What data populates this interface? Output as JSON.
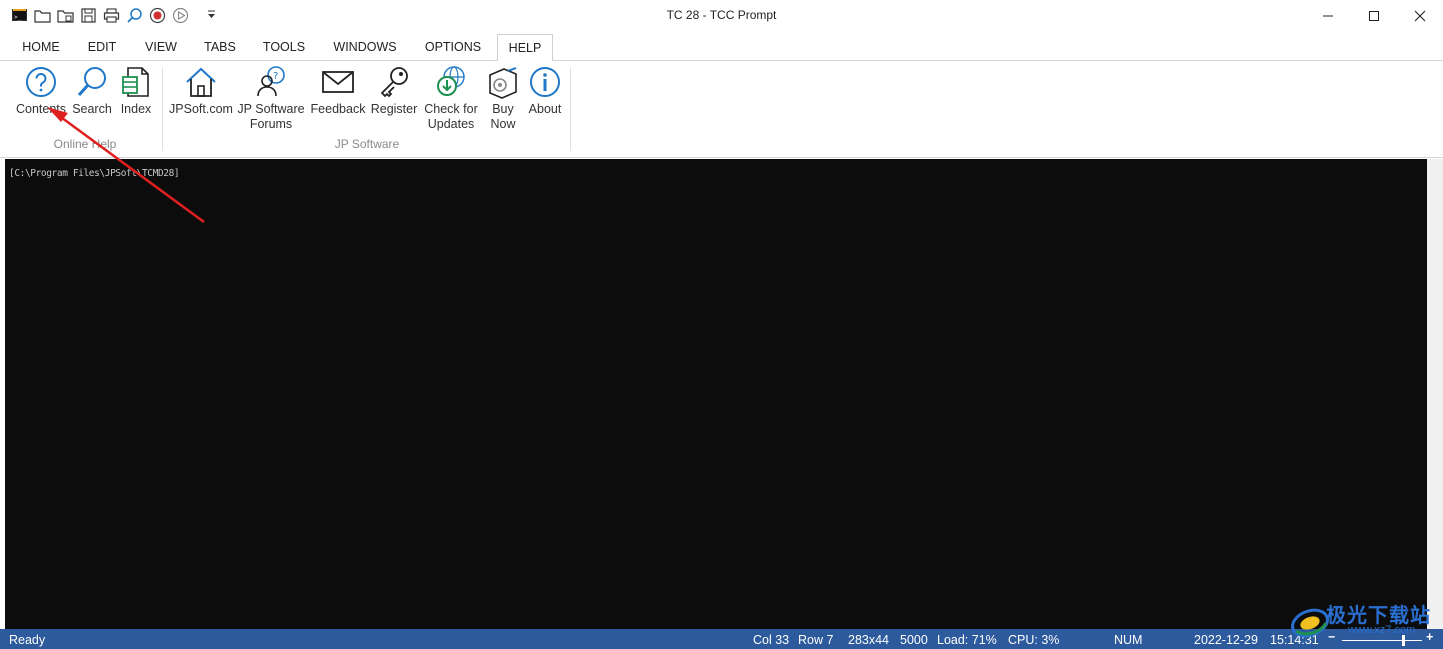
{
  "window": {
    "title": "TC 28 - TCC Prompt"
  },
  "quick_access": [
    {
      "name": "app-icon"
    },
    {
      "name": "new-folder-icon"
    },
    {
      "name": "open-folder-icon"
    },
    {
      "name": "save-icon"
    },
    {
      "name": "print-icon"
    },
    {
      "name": "search-icon"
    },
    {
      "name": "record-icon"
    },
    {
      "name": "play-icon"
    },
    {
      "name": "dropdown-icon"
    }
  ],
  "menu_tabs": [
    {
      "label": "HOME"
    },
    {
      "label": "EDIT"
    },
    {
      "label": "VIEW"
    },
    {
      "label": "TABS"
    },
    {
      "label": "TOOLS"
    },
    {
      "label": "WINDOWS"
    },
    {
      "label": "OPTIONS"
    },
    {
      "label": "HELP",
      "active": true
    }
  ],
  "ribbon": {
    "groups": [
      {
        "label": "Online Help",
        "buttons": [
          {
            "label": "Contents",
            "icon": "question-circle-icon"
          },
          {
            "label": "Search",
            "icon": "magnifier-icon"
          },
          {
            "label": "Index",
            "icon": "index-icon"
          }
        ]
      },
      {
        "label": "JP Software",
        "buttons": [
          {
            "label": "JPSoft.com",
            "icon": "home-icon"
          },
          {
            "label": "JP Software",
            "label2": "Forums",
            "icon": "forums-icon"
          },
          {
            "label": "Feedback",
            "icon": "envelope-icon"
          },
          {
            "label": "Register",
            "icon": "key-icon"
          },
          {
            "label": "Check for",
            "label2": "Updates",
            "icon": "globe-download-icon"
          },
          {
            "label": "Buy",
            "label2": "Now",
            "icon": "buy-box-icon"
          },
          {
            "label": "About",
            "icon": "info-circle-icon"
          }
        ]
      }
    ]
  },
  "console": {
    "prompt": "[C:\\Program Files\\JPSoft\\TCMD28]"
  },
  "status_bar": {
    "ready": "Ready",
    "col": "Col 33",
    "row": "Row 7",
    "size": "283x44",
    "buffer": "5000",
    "load": "Load: 71%",
    "cpu": "CPU:  3%",
    "num": "NUM",
    "date": "2022-12-29",
    "time": "15:14:31",
    "zoom_minus": "−",
    "zoom_plus": "+"
  },
  "watermark": {
    "text": "极光下载站",
    "url": "www.xz7.com"
  },
  "colors": {
    "status_bar": "#2c5a9c",
    "console_bg": "#0c0c0c",
    "icon_blue": "#1f78c8",
    "annotation_arrow": "#e02020"
  }
}
